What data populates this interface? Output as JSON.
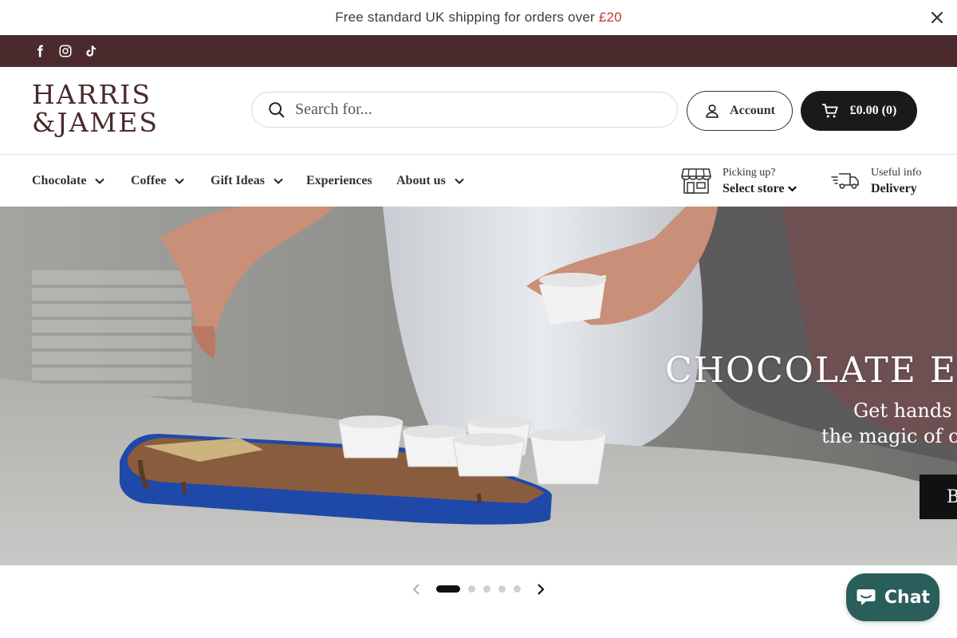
{
  "announcement": {
    "text": "Free standard UK shipping for orders over ",
    "amount": "£20",
    "close_icon": "close-icon"
  },
  "social": {
    "items": [
      {
        "icon": "facebook-icon"
      },
      {
        "icon": "instagram-icon"
      },
      {
        "icon": "tiktok-icon"
      }
    ]
  },
  "header": {
    "logo_line1": "HARRIS",
    "logo_line2": "&JAMES",
    "search_placeholder": "Search for...",
    "account_label": "Account",
    "cart_label": "£0.00 (0)"
  },
  "nav": {
    "items": [
      {
        "label": "Chocolate",
        "has_dropdown": true
      },
      {
        "label": "Coffee",
        "has_dropdown": true
      },
      {
        "label": "Gift Ideas",
        "has_dropdown": true
      },
      {
        "label": "Experiences",
        "has_dropdown": false
      },
      {
        "label": "About us",
        "has_dropdown": true
      }
    ],
    "store": {
      "small": "Picking up?",
      "strong": "Select store"
    },
    "delivery": {
      "small": "Useful info",
      "strong": "Delivery"
    }
  },
  "hero": {
    "title": "CHOCOLATE EXPI",
    "subtitle_line1": "Get hands o",
    "subtitle_line2": "the magic of cho",
    "cta": "B"
  },
  "carousel": {
    "slide_count": 5,
    "active_index": 0
  },
  "chat": {
    "label": "Chat"
  },
  "colors": {
    "brand": "#4a2a2c",
    "accent_price": "#c0392b",
    "chat": "#2a5e5a"
  }
}
